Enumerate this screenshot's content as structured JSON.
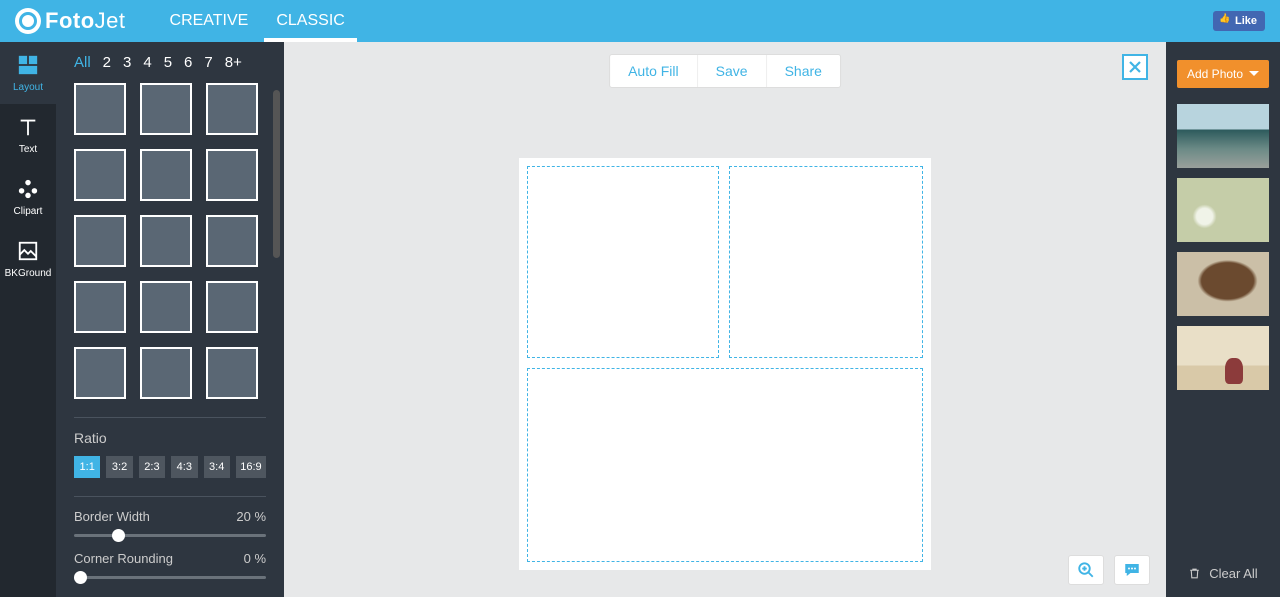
{
  "header": {
    "brand_prefix": "Foto",
    "brand_suffix": "Jet",
    "modes": [
      "CREATIVE",
      "CLASSIC"
    ],
    "active_mode": 1,
    "fb_like": "Like"
  },
  "left_nav": {
    "items": [
      {
        "label": "Layout",
        "icon": "layout-icon"
      },
      {
        "label": "Text",
        "icon": "text-icon"
      },
      {
        "label": "Clipart",
        "icon": "clipart-icon"
      },
      {
        "label": "BKGround",
        "icon": "background-icon"
      }
    ],
    "active": 0
  },
  "layout_panel": {
    "cell_filters": [
      "All",
      "2",
      "3",
      "4",
      "5",
      "6",
      "7",
      "8+"
    ],
    "active_filter": 0,
    "ratio_label": "Ratio",
    "ratios": [
      "1:1",
      "3:2",
      "2:3",
      "4:3",
      "3:4",
      "16:9"
    ],
    "active_ratio": 0,
    "border_width_label": "Border Width",
    "border_width_value": "20",
    "border_width_unit": "%",
    "corner_rounding_label": "Corner Rounding",
    "corner_rounding_value": "0",
    "corner_rounding_unit": "%"
  },
  "canvas_actions": {
    "auto_fill": "Auto Fill",
    "save": "Save",
    "share": "Share"
  },
  "right_panel": {
    "add_photo": "Add Photo",
    "clear_all": "Clear All"
  }
}
